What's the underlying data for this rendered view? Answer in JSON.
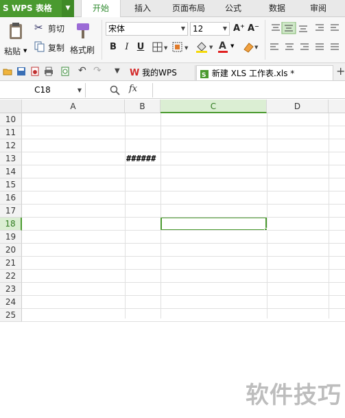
{
  "app": {
    "name": "WPS 表格",
    "menu_tabs": [
      "开始",
      "插入",
      "页面布局",
      "公式",
      "数据",
      "审阅"
    ],
    "active_tab": "开始",
    "accent": "#4a9a2f"
  },
  "ribbon": {
    "paste_label": "粘贴",
    "cut_label": "剪切",
    "copy_label": "复制",
    "format_painter_label": "格式刷",
    "font_name": "宋体",
    "font_size": "12",
    "bold": "B",
    "italic": "I",
    "underline": "U",
    "grow_font": "A⁺",
    "shrink_font": "A⁻",
    "font_color_letter": "A"
  },
  "doc_tabs": [
    {
      "label": "我的WPS",
      "active": false
    },
    {
      "label": "新建 XLS 工作表.xls *",
      "active": true
    }
  ],
  "formula_bar": {
    "name_box": "C18",
    "fx_label": "fx",
    "value": ""
  },
  "sheet": {
    "columns": [
      "A",
      "B",
      "C",
      "D"
    ],
    "rows": [
      "10",
      "11",
      "12",
      "13",
      "14",
      "15",
      "16",
      "17",
      "18",
      "19",
      "20",
      "21",
      "22",
      "23",
      "24",
      "25"
    ],
    "selected_cell": "C18",
    "cell_b13": "######"
  },
  "watermark": "软件技巧"
}
